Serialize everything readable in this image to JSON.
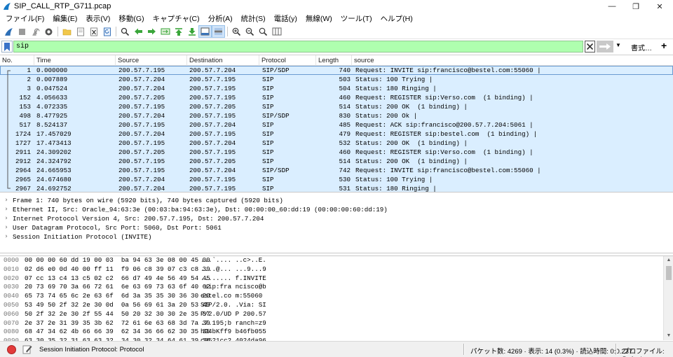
{
  "window": {
    "title": "SIP_CALL_RTP_G711.pcap",
    "minimize": "—",
    "restore": "❐",
    "close": "✕"
  },
  "menu": [
    "ファイル(F)",
    "編集(E)",
    "表示(V)",
    "移動(G)",
    "キャプチャ(C)",
    "分析(A)",
    "統計(S)",
    "電話(y)",
    "無線(W)",
    "ツール(T)",
    "ヘルプ(H)"
  ],
  "toolbar": {
    "icons": [
      "shark-fin-start-icon",
      "stop-square-icon",
      "restart-icon",
      "options-gear-icon",
      "open-folder-icon",
      "save-file-icon",
      "close-file-icon",
      "reload-icon",
      "find-magnifier-icon",
      "go-back-arrow-icon",
      "go-forward-arrow-icon",
      "go-to-packet-icon",
      "first-packet-icon",
      "last-packet-icon",
      "autoscroll-icon",
      "colorize-icon",
      "zoom-in-icon",
      "zoom-out-icon",
      "normal-size-icon",
      "resize-columns-icon"
    ]
  },
  "filter": {
    "value": "sip",
    "expression_label": "書式…",
    "add_label": "+"
  },
  "packet_list": {
    "columns": [
      "No.",
      "Time",
      "Source",
      "Destination",
      "Protocol",
      "Length",
      "source"
    ],
    "rows": [
      {
        "no": "1",
        "time": "0.000000",
        "src": "200.57.7.195",
        "dst": "200.57.7.204",
        "proto": "SIP/SDP",
        "len": "740",
        "info": "Request: INVITE sip:francisco@bestel.com:55060 |"
      },
      {
        "no": "2",
        "time": "0.007889",
        "src": "200.57.7.204",
        "dst": "200.57.7.195",
        "proto": "SIP",
        "len": "503",
        "info": "Status: 100 Trying |"
      },
      {
        "no": "3",
        "time": "0.047524",
        "src": "200.57.7.204",
        "dst": "200.57.7.195",
        "proto": "SIP",
        "len": "504",
        "info": "Status: 180 Ringing |"
      },
      {
        "no": "152",
        "time": "4.056633",
        "src": "200.57.7.205",
        "dst": "200.57.7.195",
        "proto": "SIP",
        "len": "460",
        "info": "Request: REGISTER sip:Verso.com  (1 binding) |"
      },
      {
        "no": "153",
        "time": "4.072335",
        "src": "200.57.7.195",
        "dst": "200.57.7.205",
        "proto": "SIP",
        "len": "514",
        "info": "Status: 200 OK  (1 binding) |"
      },
      {
        "no": "498",
        "time": "8.477925",
        "src": "200.57.7.204",
        "dst": "200.57.7.195",
        "proto": "SIP/SDP",
        "len": "830",
        "info": "Status: 200 Ok |"
      },
      {
        "no": "517",
        "time": "8.524137",
        "src": "200.57.7.195",
        "dst": "200.57.7.204",
        "proto": "SIP",
        "len": "485",
        "info": "Request: ACK sip:francisco@200.57.7.204:5061 |"
      },
      {
        "no": "1724",
        "time": "17.457029",
        "src": "200.57.7.204",
        "dst": "200.57.7.195",
        "proto": "SIP",
        "len": "479",
        "info": "Request: REGISTER sip:bestel.com  (1 binding) |"
      },
      {
        "no": "1727",
        "time": "17.473413",
        "src": "200.57.7.195",
        "dst": "200.57.7.204",
        "proto": "SIP",
        "len": "532",
        "info": "Status: 200 OK  (1 binding) |"
      },
      {
        "no": "2911",
        "time": "24.309202",
        "src": "200.57.7.205",
        "dst": "200.57.7.195",
        "proto": "SIP",
        "len": "460",
        "info": "Request: REGISTER sip:Verso.com  (1 binding) |"
      },
      {
        "no": "2912",
        "time": "24.324792",
        "src": "200.57.7.195",
        "dst": "200.57.7.205",
        "proto": "SIP",
        "len": "514",
        "info": "Status: 200 OK  (1 binding) |"
      },
      {
        "no": "2964",
        "time": "24.665953",
        "src": "200.57.7.195",
        "dst": "200.57.7.204",
        "proto": "SIP/SDP",
        "len": "742",
        "info": "Request: INVITE sip:francisco@bestel.com:55060 |"
      },
      {
        "no": "2965",
        "time": "24.674680",
        "src": "200.57.7.204",
        "dst": "200.57.7.195",
        "proto": "SIP",
        "len": "530",
        "info": "Status: 100 Trying |"
      },
      {
        "no": "2967",
        "time": "24.692752",
        "src": "200.57.7.204",
        "dst": "200.57.7.195",
        "proto": "SIP",
        "len": "531",
        "info": "Status: 180 Ringing |"
      }
    ]
  },
  "details": [
    "Frame 1: 740 bytes on wire (5920 bits), 740 bytes captured (5920 bits)",
    "Ethernet II, Src: Oracle_94:63:3e (00:03:ba:94:63:3e), Dst: 00:00:00_60:dd:19 (00:00:00:60:dd:19)",
    "Internet Protocol Version 4, Src: 200.57.7.195, Dst: 200.57.7.204",
    "User Datagram Protocol, Src Port: 5060, Dst Port: 5061",
    "Session Initiation Protocol (INVITE)"
  ],
  "bytes": [
    {
      "off": "0000",
      "hex": "00 00 00 60 dd 19 00 03  ba 94 63 3e 08 00 45 00",
      "ascii": "...`.... ..c>..E."
    },
    {
      "off": "0010",
      "hex": "02 d6 e0 0d 40 00 ff 11  f9 06 c8 39 07 c3 c8 39",
      "ascii": "....@... ...9...9"
    },
    {
      "off": "0020",
      "hex": "07 cc 13 c4 13 c5 02 c2  66 d7 49 4e 56 49 54 45",
      "ascii": "........ f.INVITE"
    },
    {
      "off": "0030",
      "hex": "20 73 69 70 3a 66 72 61  6e 63 69 73 63 6f 40 62",
      "ascii": " sip:fra ncisco@b"
    },
    {
      "off": "0040",
      "hex": "65 73 74 65 6c 2e 63 6f  6d 3a 35 35 30 36 30 20",
      "ascii": "estel.co m:55060 "
    },
    {
      "off": "0050",
      "hex": "53 49 50 2f 32 2e 30 0d  0a 56 69 61 3a 20 53 49",
      "ascii": "SIP/2.0. .Via: SI"
    },
    {
      "off": "0060",
      "hex": "50 2f 32 2e 30 2f 55 44  50 20 32 30 30 2e 35 37",
      "ascii": "P/2.0/UD P 200.57"
    },
    {
      "off": "0070",
      "hex": "2e 37 2e 31 39 35 3b 62  72 61 6e 63 68 3d 7a 39",
      "ascii": ".7.195;b ranch=z9"
    },
    {
      "off": "0080",
      "hex": "68 47 34 62 4b 66 66 39  62 34 36 66 62 30 35 35",
      "ascii": "hG4bKff9 b46fb055"
    },
    {
      "off": "0090",
      "hex": "63 30 35 32 31 63 63 32  34 30 32 34 64 61 39 36",
      "ascii": "c0521cc2 4024da96"
    },
    {
      "off": "00a0",
      "hex": "63 64 32 39 30 0d 0a 56  69 61 3a 20 53 49 50 2f",
      "ascii": "cd290..V ia: SIP/"
    }
  ],
  "status": {
    "protocol_text": "Session Initiation Protocol: Protocol",
    "counts": "パケット数: 4269 · 表示: 14 (0.3%) · 読込時間: 0:0.237",
    "profile": "プロファイル: Default"
  },
  "colors": {
    "filter_ok": "#afffaf",
    "row_bg": "#daeeff",
    "record_button": "#e23a3a"
  }
}
